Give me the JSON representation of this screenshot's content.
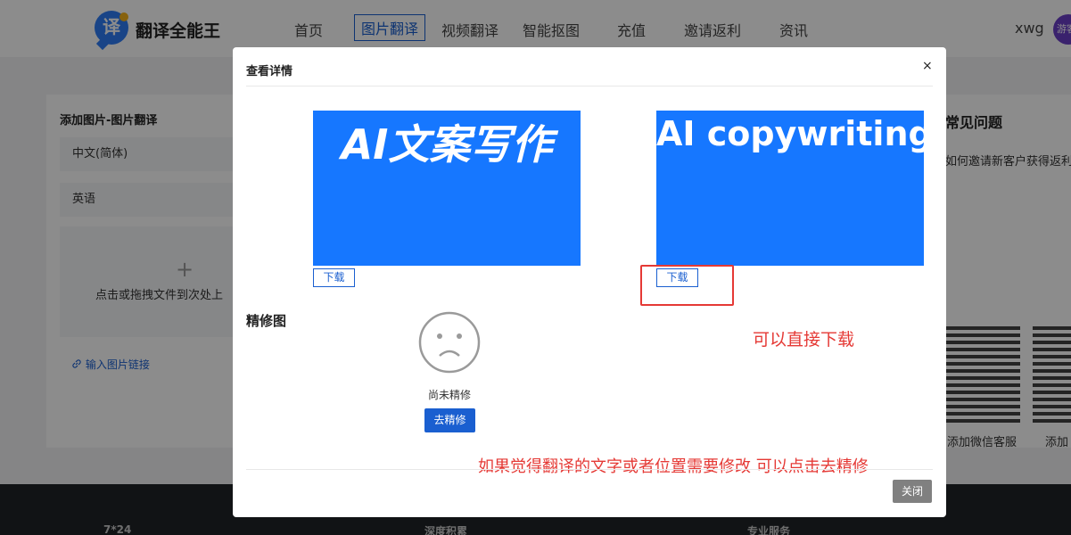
{
  "header": {
    "logo_glyph": "译",
    "brand": "翻译全能王",
    "nav": [
      "首页",
      "图片翻译",
      "视频翻译",
      "智能抠图",
      "充值",
      "邀请返利",
      "资讯"
    ],
    "active_nav": "图片翻译",
    "username": "xwg",
    "avatar_label": "游客"
  },
  "left_panel": {
    "title": "添加图片-图片翻译",
    "source_lang": "中文(简体)",
    "target_lang": "英语",
    "upload_plus": "+",
    "upload_text": "点击或拖拽文件到次处上",
    "link_icon": "link-icon",
    "link_text": "输入图片链接"
  },
  "right_panel": {
    "title": "常见问题",
    "question": "如何邀请新客户获得返利",
    "qr_captions": [
      "添加微信客服",
      "添加"
    ]
  },
  "footer": {
    "items": [
      "7*24",
      "深度积累",
      "专业服务"
    ]
  },
  "modal": {
    "title": "查看详情",
    "close_x": "×",
    "original_image_text": "AI文案写作",
    "translated_image_text": "AI copywriting",
    "download_label": "下载",
    "refine_section_label": "精修图",
    "face_icon": "sad-face-icon",
    "not_refined_text": "尚未精修",
    "refine_button": "去精修",
    "close_button": "关闭"
  },
  "annotations": {
    "download_note": "可以直接下载",
    "refine_note": "如果觉得翻译的文字或者位置需要修改 可以点击去精修",
    "color": "#e53935"
  },
  "colors": {
    "accent": "#1a5fd0",
    "image_bg": "#1677ff",
    "overlay": "rgba(0,0,0,0.45)"
  }
}
